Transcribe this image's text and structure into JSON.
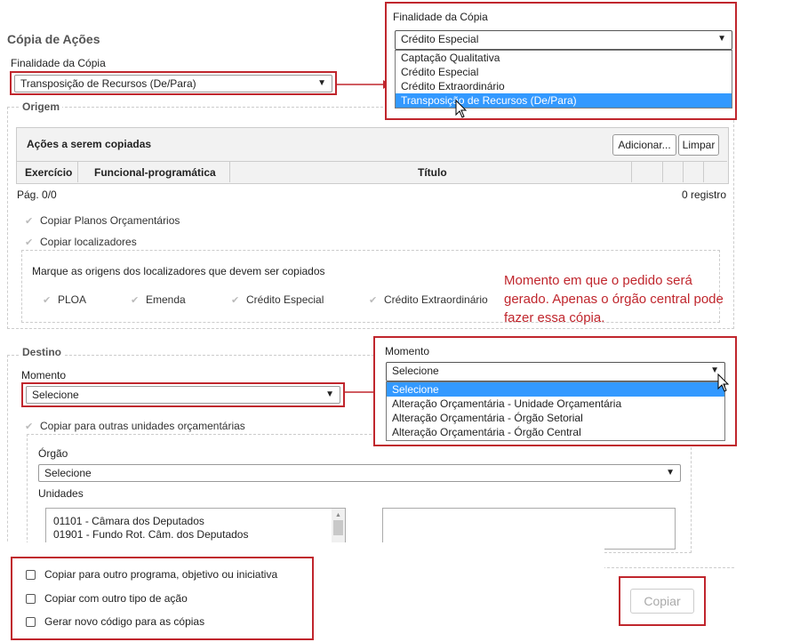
{
  "page": {
    "title": "Cópia de Ações"
  },
  "finalidade": {
    "label": "Finalidade da Cópia",
    "value": "Transposição de Recursos (De/Para)"
  },
  "finalidade_popup": {
    "label": "Finalidade da Cópia",
    "value": "Crédito Especial",
    "options": [
      "Captação Qualitativa",
      "Crédito Especial",
      "Crédito Extraordinário",
      "Transposição de Recursos (De/Para)"
    ],
    "highlighted": "Transposição de Recursos (De/Para)"
  },
  "origem": {
    "legend": "Origem",
    "acoes_title": "Ações a serem copiadas",
    "add_button": "Adicionar...",
    "clear_button": "Limpar",
    "columns": [
      "Exercício",
      "Funcional-programática",
      "Título"
    ],
    "page_info": "Pág. 0/0",
    "registros": "0 registro",
    "copiar_planos": "Copiar Planos Orçamentários",
    "copiar_localizadores": "Copiar localizadores",
    "marque_label": "Marque as origens dos localizadores que devem ser copiados",
    "origens": [
      "PLOA",
      "Emenda",
      "Crédito Especial",
      "Crédito Extraordinário"
    ]
  },
  "note": "Momento em que o pedido será gerado. Apenas o órgão central pode fazer essa cópia.",
  "destino": {
    "legend": "Destino",
    "momento_label": "Momento",
    "momento_value": "Selecione",
    "copiar_outras": "Copiar para outras unidades orçamentárias",
    "orgao_label": "Órgão",
    "orgao_value": "Selecione",
    "unidades_label": "Unidades",
    "unidades": [
      "01101 - Câmara dos Deputados",
      "01901 - Fundo Rot. Câm. dos Deputados"
    ]
  },
  "momento_popup": {
    "label": "Momento",
    "value": "Selecione",
    "options": [
      "Selecione",
      "Alteração Orçamentária - Unidade Orçamentária",
      "Alteração Orçamentária - Órgão Setorial",
      "Alteração Orçamentária - Órgão Central"
    ],
    "highlighted": "Selecione"
  },
  "options_bottom": [
    "Copiar para outro programa, objetivo ou iniciativa",
    "Copiar com outro tipo de ação",
    "Gerar novo código para as cópias"
  ],
  "copiar_button": "Copiar",
  "colors": {
    "annotation": "#c0262d",
    "highlight": "#3399ff"
  }
}
